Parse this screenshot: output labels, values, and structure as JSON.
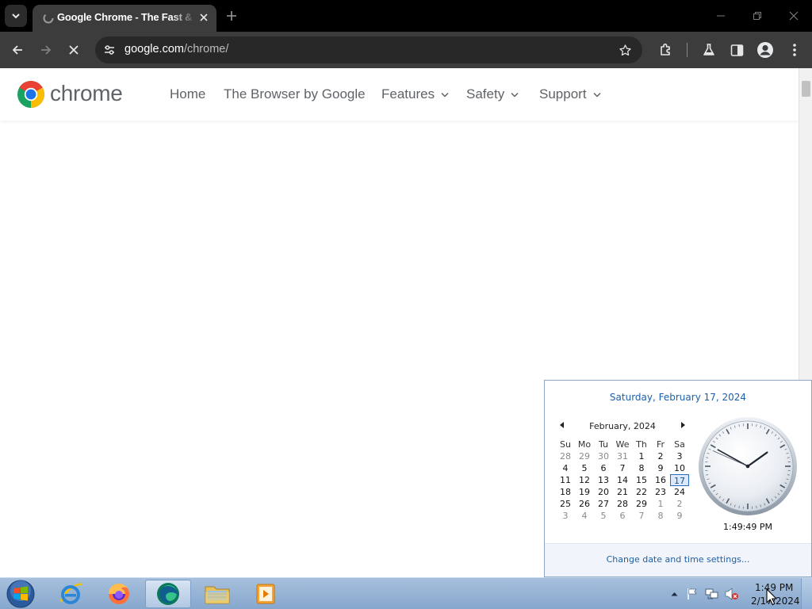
{
  "browser": {
    "tab": {
      "title": "Google Chrome - The Fast & Secure Web Browser Built to be Yours"
    },
    "omnibox": {
      "url_host": "google.com",
      "url_path": "/chrome/"
    }
  },
  "site": {
    "brand": "chrome",
    "nav": [
      {
        "label": "Home",
        "has_dropdown": false
      },
      {
        "label": "The Browser by Google",
        "has_dropdown": false
      },
      {
        "label": "Features",
        "has_dropdown": true
      },
      {
        "label": "Safety",
        "has_dropdown": true
      },
      {
        "label": "Support",
        "has_dropdown": true
      }
    ]
  },
  "clock_popup": {
    "date_heading": "Saturday, February 17, 2024",
    "month_label": "February, 2024",
    "weekdays": [
      "Su",
      "Mo",
      "Tu",
      "We",
      "Th",
      "Fr",
      "Sa"
    ],
    "weeks": [
      [
        "28",
        "29",
        "30",
        "31",
        "1",
        "2",
        "3"
      ],
      [
        "4",
        "5",
        "6",
        "7",
        "8",
        "9",
        "10"
      ],
      [
        "11",
        "12",
        "13",
        "14",
        "15",
        "16",
        "17"
      ],
      [
        "18",
        "19",
        "20",
        "21",
        "22",
        "23",
        "24"
      ],
      [
        "25",
        "26",
        "27",
        "28",
        "29",
        "1",
        "2"
      ],
      [
        "3",
        "4",
        "5",
        "6",
        "7",
        "8",
        "9"
      ]
    ],
    "today": "17",
    "digital_time": "1:49:49 PM",
    "change_settings_link": "Change date and time settings..."
  },
  "taskbar": {
    "tray_time": "1:49 PM",
    "tray_date": "2/17/2024"
  },
  "colors": {
    "chrome_dark": "#3c3c3c",
    "link_blue": "#1e5fa8",
    "taskbar": "#a7c0dd"
  }
}
